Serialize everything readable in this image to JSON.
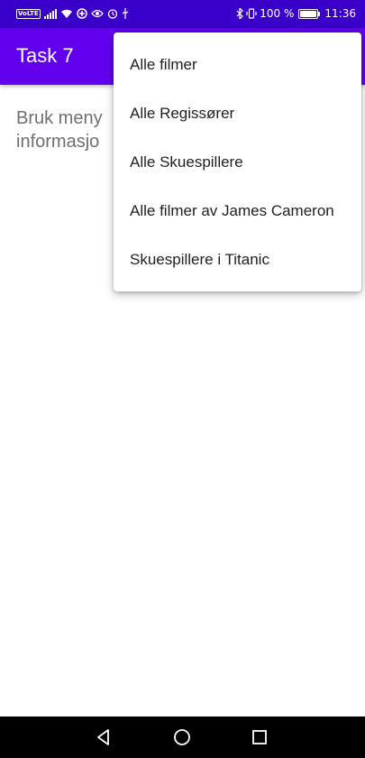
{
  "status_bar": {
    "volte": "VoLTE",
    "battery_percent": "100 %",
    "time": "11:36",
    "icons": [
      "volte-icon",
      "signal-icon",
      "wifi-icon",
      "data-saver-icon",
      "eye-comfort-icon",
      "alarm-icon",
      "usb-icon",
      "bluetooth-icon",
      "vibrate-icon",
      "battery-charging-icon"
    ]
  },
  "app_bar": {
    "title": "Task 7",
    "color": "#6200ee"
  },
  "content": {
    "line1": "Bruk meny",
    "line2": "informasjo"
  },
  "menu": {
    "items": [
      {
        "label": "Alle filmer"
      },
      {
        "label": "Alle Regissører"
      },
      {
        "label": "Alle Skuespillere"
      },
      {
        "label": "Alle filmer av James Cameron"
      },
      {
        "label": "Skuespillere i Titanic"
      }
    ]
  },
  "nav_bar": {
    "buttons": [
      "back-icon",
      "home-icon",
      "recents-icon"
    ]
  }
}
